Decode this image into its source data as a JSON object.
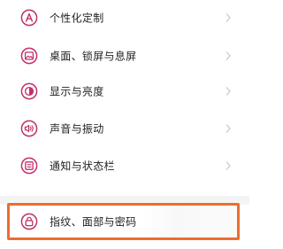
{
  "settings": {
    "items": [
      {
        "label": "个性化定制",
        "icon": "personalize-icon"
      },
      {
        "label": "桌面、锁屏与息屏",
        "icon": "wallpaper-icon"
      },
      {
        "label": "显示与亮度",
        "icon": "display-brightness-icon"
      },
      {
        "label": "声音与振动",
        "icon": "sound-vibration-icon"
      },
      {
        "label": "通知与状态栏",
        "icon": "notification-statusbar-icon"
      },
      {
        "label": "指纹、面部与密码",
        "icon": "lock-icon"
      }
    ]
  },
  "colors": {
    "icon_accent": "#c0306a",
    "highlight_border": "#ee6d2f",
    "chevron": "#c8c8c8",
    "text": "#222222"
  }
}
